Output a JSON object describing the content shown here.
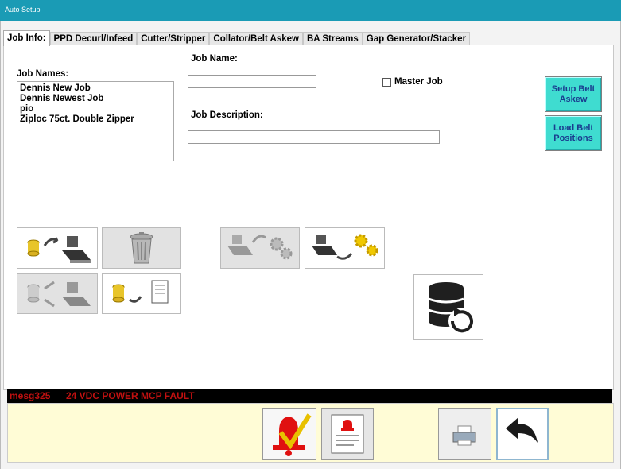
{
  "window": {
    "title": "Auto Setup"
  },
  "tabs": [
    {
      "label": "Job Info:"
    },
    {
      "label": "PPD Decurl/Infeed"
    },
    {
      "label": "Cutter/Stripper"
    },
    {
      "label": "Collator/Belt Askew"
    },
    {
      "label": "BA Streams"
    },
    {
      "label": "Gap Generator/Stacker"
    }
  ],
  "job_info": {
    "job_names_label": "Job Names:",
    "job_names": [
      "Dennis New Job",
      "Dennis Newest Job",
      "pio",
      "Ziploc 75ct. Double Zipper"
    ],
    "job_name_label": "Job Name:",
    "job_name_value": "",
    "job_description_label": "Job Description:",
    "job_description_value": "",
    "master_job_label": "Master Job",
    "master_job_checked": false,
    "setup_belt_askew_label": "Setup Belt Askew",
    "load_belt_positions_label": "Load Belt Positions"
  },
  "status": {
    "code": "mesg325",
    "message": "24 VDC POWER MCP FAULT",
    "color": "#c01010"
  },
  "colors": {
    "titlebar": "#1a9bb5",
    "teal_button": "#3fdcd0",
    "bottom_bar": "#fffcd6"
  }
}
